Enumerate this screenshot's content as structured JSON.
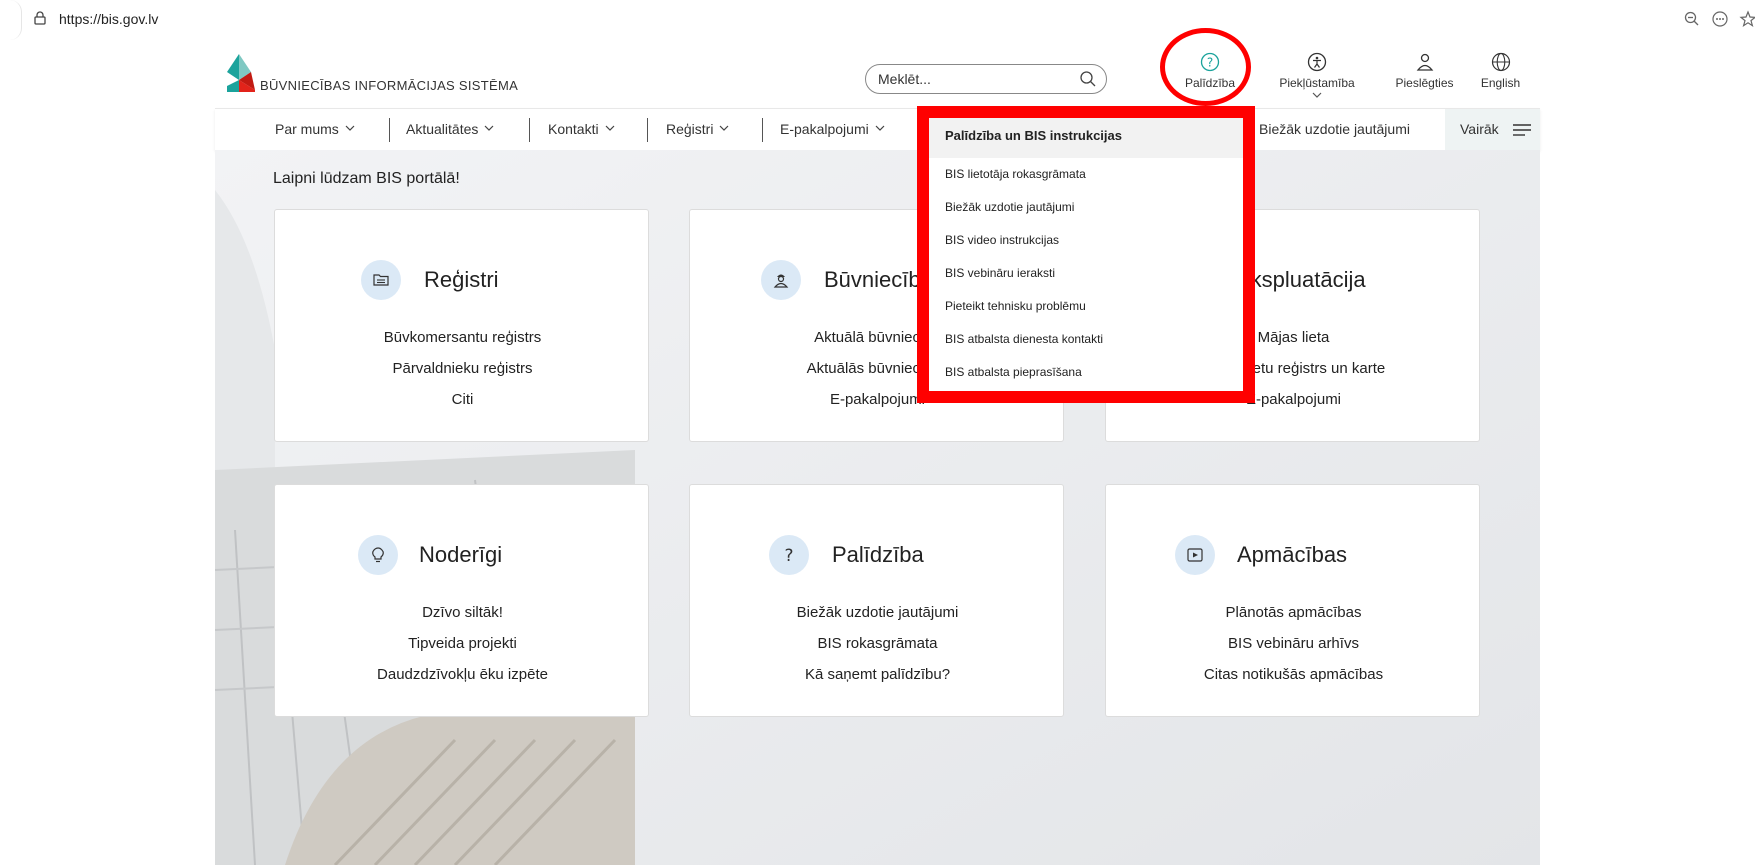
{
  "browser": {
    "url": "https://bis.gov.lv"
  },
  "header": {
    "logo_text": "BŪVNIECĪBAS INFORMĀCIJAS SISTĒMA",
    "search_placeholder": "Meklēt...",
    "tools": {
      "help": "Palīdzība",
      "accessibility": "Piekļūstamība",
      "login": "Pieslēgties",
      "language": "English"
    }
  },
  "nav": {
    "items": [
      "Par mums",
      "Aktualitātes",
      "Kontakti",
      "Reģistri",
      "E-pakalpojumi"
    ],
    "right_link": "Biežāk uzdotie jautājumi",
    "more": "Vairāk"
  },
  "main": {
    "welcome": "Laipni lūdzam BIS portālā!",
    "cards": [
      {
        "title": "Reģistri",
        "icon": "folder-icon",
        "links": [
          "Būvkomersantu reģistrs",
          "Pārvaldnieku reģistrs",
          "Citi"
        ]
      },
      {
        "title": "Būvniecība",
        "icon": "worker-icon",
        "links": [
          "Aktuālā būvniecība",
          "Aktuālās būvniecības",
          "E-pakalpojumi"
        ]
      },
      {
        "title": "Ekspluatācija",
        "icon": "house-icon",
        "links": [
          "Mājas lieta",
          "Mājas lietu reģistrs un karte",
          "E-pakalpojumi"
        ]
      },
      {
        "title": "Noderīgi",
        "icon": "lightbulb-icon",
        "links": [
          "Dzīvo siltāk!",
          "Tipveida projekti",
          "Daudzdzīvokļu ēku izpēte"
        ]
      },
      {
        "title": "Palīdzība",
        "icon": "question-icon",
        "links": [
          "Biežāk uzdotie jautājumi",
          "BIS rokasgrāmata",
          "Kā saņemt palīdzību?"
        ]
      },
      {
        "title": "Apmācības",
        "icon": "play-icon",
        "links": [
          "Plānotās apmācības",
          "BIS vebināru arhīvs",
          "Citas notikušās apmācības"
        ]
      }
    ]
  },
  "dropdown": {
    "heading": "Palīdzība un BIS instrukcijas",
    "items": [
      "BIS lietotāja rokasgrāmata",
      "Biežāk uzdotie jautājumi",
      "BIS video instrukcijas",
      "BIS vebināru ieraksti",
      "Pieteikt tehnisku problēmu",
      "BIS atbalsta dienesta kontakti",
      "BIS atbalsta pieprasīšana"
    ]
  },
  "colors": {
    "annotation": "#ff0000",
    "icon_circle": "#dbe9f6",
    "logo_teal": "#1ba39c",
    "logo_red": "#e2231a"
  }
}
